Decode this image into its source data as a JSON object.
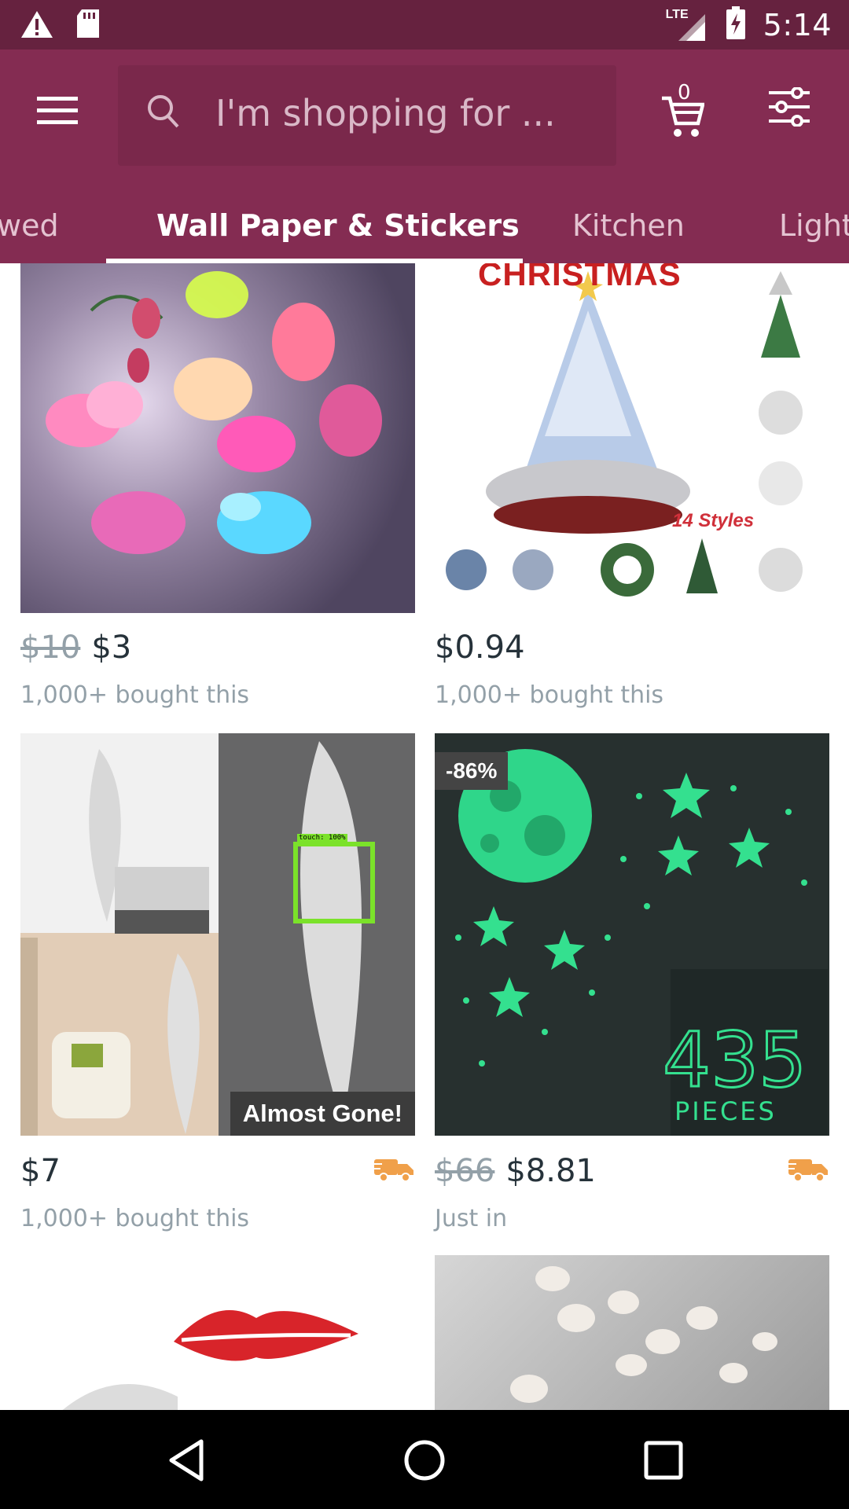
{
  "status_bar": {
    "network": "LTE",
    "time": "5:14"
  },
  "header": {
    "search_placeholder": "I'm shopping for ...",
    "cart_count": "0"
  },
  "tabs": [
    {
      "label": "wed",
      "active": false
    },
    {
      "label": "Wall Paper & Stickers",
      "active": true
    },
    {
      "label": "Kitchen",
      "active": false
    },
    {
      "label": "Light",
      "active": false
    }
  ],
  "products": [
    {
      "old_price": "$10",
      "price": "$3",
      "sub": "1,000+ bought this",
      "image": "butterfly-led-lights"
    },
    {
      "old_price": "",
      "price": "$0.94",
      "sub": "1,000+ bought this",
      "image": "christmas-tree-ornament",
      "image_text": "CHRISTMAS",
      "image_text2": "14 Styles"
    },
    {
      "old_price": "",
      "price": "$7",
      "sub": "1,000+ bought this",
      "image": "feather-mirror-sticker",
      "tag": "Almost Gone!",
      "shipping_icon": "truck-icon",
      "overlay": "touch: 100%"
    },
    {
      "old_price": "$66",
      "price": "$8.81",
      "sub": "Just in",
      "image": "glow-moon-stars",
      "badge": "-86%",
      "image_text": "435",
      "image_text2": "PIECES",
      "shipping_icon": "truck-icon"
    },
    {
      "image": "lips-mirror-sticker"
    },
    {
      "image": "mirror-butterflies"
    }
  ],
  "colors": {
    "status_bar": "#66223f",
    "header": "#842c52",
    "truck": "#f0a04a"
  }
}
